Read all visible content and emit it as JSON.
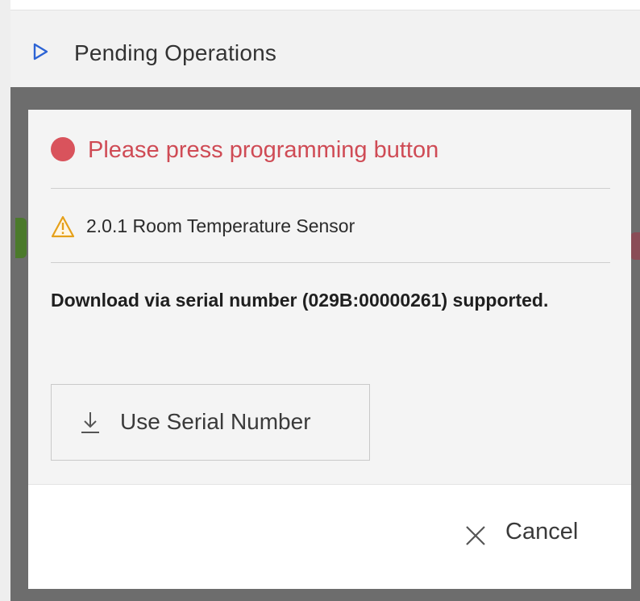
{
  "header": {
    "title": "Pending Operations",
    "icon": "play-triangle-icon",
    "icon_color": "#2c63d4"
  },
  "dialog": {
    "status": {
      "text": "Please press programming button",
      "icon": "status-dot-icon",
      "color": "#d9535c"
    },
    "device": {
      "text": "2.0.1 Room Temperature Sensor",
      "icon": "warning-icon",
      "icon_color": "#e5a01a"
    },
    "message": "Download via serial number (029B:00000261) supported.",
    "serial_button": {
      "label": "Use Serial Number",
      "icon": "download-icon"
    },
    "cancel_button": {
      "label": "Cancel",
      "icon": "close-icon"
    }
  }
}
